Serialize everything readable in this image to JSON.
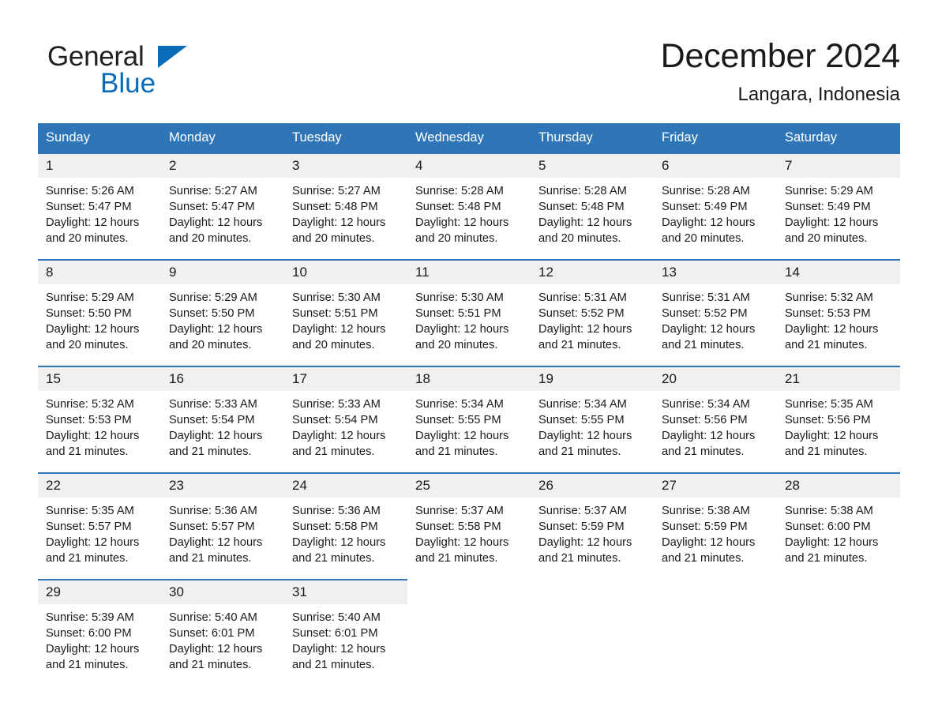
{
  "brand": {
    "name_part1": "General",
    "name_part2": "Blue",
    "logo_icon": "triangle-icon",
    "accent_color": "#0a6cb6"
  },
  "header": {
    "title": "December 2024",
    "location": "Langara, Indonesia"
  },
  "calendar": {
    "header_color": "#2f76b8",
    "daynum_band_color": "#f0f0f0",
    "weekday_headers": [
      "Sunday",
      "Monday",
      "Tuesday",
      "Wednesday",
      "Thursday",
      "Friday",
      "Saturday"
    ],
    "weeks": [
      [
        {
          "day": "1",
          "sunrise": "Sunrise: 5:26 AM",
          "sunset": "Sunset: 5:47 PM",
          "daylight_line1": "Daylight: 12 hours",
          "daylight_line2": "and 20 minutes."
        },
        {
          "day": "2",
          "sunrise": "Sunrise: 5:27 AM",
          "sunset": "Sunset: 5:47 PM",
          "daylight_line1": "Daylight: 12 hours",
          "daylight_line2": "and 20 minutes."
        },
        {
          "day": "3",
          "sunrise": "Sunrise: 5:27 AM",
          "sunset": "Sunset: 5:48 PM",
          "daylight_line1": "Daylight: 12 hours",
          "daylight_line2": "and 20 minutes."
        },
        {
          "day": "4",
          "sunrise": "Sunrise: 5:28 AM",
          "sunset": "Sunset: 5:48 PM",
          "daylight_line1": "Daylight: 12 hours",
          "daylight_line2": "and 20 minutes."
        },
        {
          "day": "5",
          "sunrise": "Sunrise: 5:28 AM",
          "sunset": "Sunset: 5:48 PM",
          "daylight_line1": "Daylight: 12 hours",
          "daylight_line2": "and 20 minutes."
        },
        {
          "day": "6",
          "sunrise": "Sunrise: 5:28 AM",
          "sunset": "Sunset: 5:49 PM",
          "daylight_line1": "Daylight: 12 hours",
          "daylight_line2": "and 20 minutes."
        },
        {
          "day": "7",
          "sunrise": "Sunrise: 5:29 AM",
          "sunset": "Sunset: 5:49 PM",
          "daylight_line1": "Daylight: 12 hours",
          "daylight_line2": "and 20 minutes."
        }
      ],
      [
        {
          "day": "8",
          "sunrise": "Sunrise: 5:29 AM",
          "sunset": "Sunset: 5:50 PM",
          "daylight_line1": "Daylight: 12 hours",
          "daylight_line2": "and 20 minutes."
        },
        {
          "day": "9",
          "sunrise": "Sunrise: 5:29 AM",
          "sunset": "Sunset: 5:50 PM",
          "daylight_line1": "Daylight: 12 hours",
          "daylight_line2": "and 20 minutes."
        },
        {
          "day": "10",
          "sunrise": "Sunrise: 5:30 AM",
          "sunset": "Sunset: 5:51 PM",
          "daylight_line1": "Daylight: 12 hours",
          "daylight_line2": "and 20 minutes."
        },
        {
          "day": "11",
          "sunrise": "Sunrise: 5:30 AM",
          "sunset": "Sunset: 5:51 PM",
          "daylight_line1": "Daylight: 12 hours",
          "daylight_line2": "and 20 minutes."
        },
        {
          "day": "12",
          "sunrise": "Sunrise: 5:31 AM",
          "sunset": "Sunset: 5:52 PM",
          "daylight_line1": "Daylight: 12 hours",
          "daylight_line2": "and 21 minutes."
        },
        {
          "day": "13",
          "sunrise": "Sunrise: 5:31 AM",
          "sunset": "Sunset: 5:52 PM",
          "daylight_line1": "Daylight: 12 hours",
          "daylight_line2": "and 21 minutes."
        },
        {
          "day": "14",
          "sunrise": "Sunrise: 5:32 AM",
          "sunset": "Sunset: 5:53 PM",
          "daylight_line1": "Daylight: 12 hours",
          "daylight_line2": "and 21 minutes."
        }
      ],
      [
        {
          "day": "15",
          "sunrise": "Sunrise: 5:32 AM",
          "sunset": "Sunset: 5:53 PM",
          "daylight_line1": "Daylight: 12 hours",
          "daylight_line2": "and 21 minutes."
        },
        {
          "day": "16",
          "sunrise": "Sunrise: 5:33 AM",
          "sunset": "Sunset: 5:54 PM",
          "daylight_line1": "Daylight: 12 hours",
          "daylight_line2": "and 21 minutes."
        },
        {
          "day": "17",
          "sunrise": "Sunrise: 5:33 AM",
          "sunset": "Sunset: 5:54 PM",
          "daylight_line1": "Daylight: 12 hours",
          "daylight_line2": "and 21 minutes."
        },
        {
          "day": "18",
          "sunrise": "Sunrise: 5:34 AM",
          "sunset": "Sunset: 5:55 PM",
          "daylight_line1": "Daylight: 12 hours",
          "daylight_line2": "and 21 minutes."
        },
        {
          "day": "19",
          "sunrise": "Sunrise: 5:34 AM",
          "sunset": "Sunset: 5:55 PM",
          "daylight_line1": "Daylight: 12 hours",
          "daylight_line2": "and 21 minutes."
        },
        {
          "day": "20",
          "sunrise": "Sunrise: 5:34 AM",
          "sunset": "Sunset: 5:56 PM",
          "daylight_line1": "Daylight: 12 hours",
          "daylight_line2": "and 21 minutes."
        },
        {
          "day": "21",
          "sunrise": "Sunrise: 5:35 AM",
          "sunset": "Sunset: 5:56 PM",
          "daylight_line1": "Daylight: 12 hours",
          "daylight_line2": "and 21 minutes."
        }
      ],
      [
        {
          "day": "22",
          "sunrise": "Sunrise: 5:35 AM",
          "sunset": "Sunset: 5:57 PM",
          "daylight_line1": "Daylight: 12 hours",
          "daylight_line2": "and 21 minutes."
        },
        {
          "day": "23",
          "sunrise": "Sunrise: 5:36 AM",
          "sunset": "Sunset: 5:57 PM",
          "daylight_line1": "Daylight: 12 hours",
          "daylight_line2": "and 21 minutes."
        },
        {
          "day": "24",
          "sunrise": "Sunrise: 5:36 AM",
          "sunset": "Sunset: 5:58 PM",
          "daylight_line1": "Daylight: 12 hours",
          "daylight_line2": "and 21 minutes."
        },
        {
          "day": "25",
          "sunrise": "Sunrise: 5:37 AM",
          "sunset": "Sunset: 5:58 PM",
          "daylight_line1": "Daylight: 12 hours",
          "daylight_line2": "and 21 minutes."
        },
        {
          "day": "26",
          "sunrise": "Sunrise: 5:37 AM",
          "sunset": "Sunset: 5:59 PM",
          "daylight_line1": "Daylight: 12 hours",
          "daylight_line2": "and 21 minutes."
        },
        {
          "day": "27",
          "sunrise": "Sunrise: 5:38 AM",
          "sunset": "Sunset: 5:59 PM",
          "daylight_line1": "Daylight: 12 hours",
          "daylight_line2": "and 21 minutes."
        },
        {
          "day": "28",
          "sunrise": "Sunrise: 5:38 AM",
          "sunset": "Sunset: 6:00 PM",
          "daylight_line1": "Daylight: 12 hours",
          "daylight_line2": "and 21 minutes."
        }
      ],
      [
        {
          "day": "29",
          "sunrise": "Sunrise: 5:39 AM",
          "sunset": "Sunset: 6:00 PM",
          "daylight_line1": "Daylight: 12 hours",
          "daylight_line2": "and 21 minutes."
        },
        {
          "day": "30",
          "sunrise": "Sunrise: 5:40 AM",
          "sunset": "Sunset: 6:01 PM",
          "daylight_line1": "Daylight: 12 hours",
          "daylight_line2": "and 21 minutes."
        },
        {
          "day": "31",
          "sunrise": "Sunrise: 5:40 AM",
          "sunset": "Sunset: 6:01 PM",
          "daylight_line1": "Daylight: 12 hours",
          "daylight_line2": "and 21 minutes."
        },
        {
          "day": "",
          "sunrise": "",
          "sunset": "",
          "daylight_line1": "",
          "daylight_line2": ""
        },
        {
          "day": "",
          "sunrise": "",
          "sunset": "",
          "daylight_line1": "",
          "daylight_line2": ""
        },
        {
          "day": "",
          "sunrise": "",
          "sunset": "",
          "daylight_line1": "",
          "daylight_line2": ""
        },
        {
          "day": "",
          "sunrise": "",
          "sunset": "",
          "daylight_line1": "",
          "daylight_line2": ""
        }
      ]
    ]
  }
}
